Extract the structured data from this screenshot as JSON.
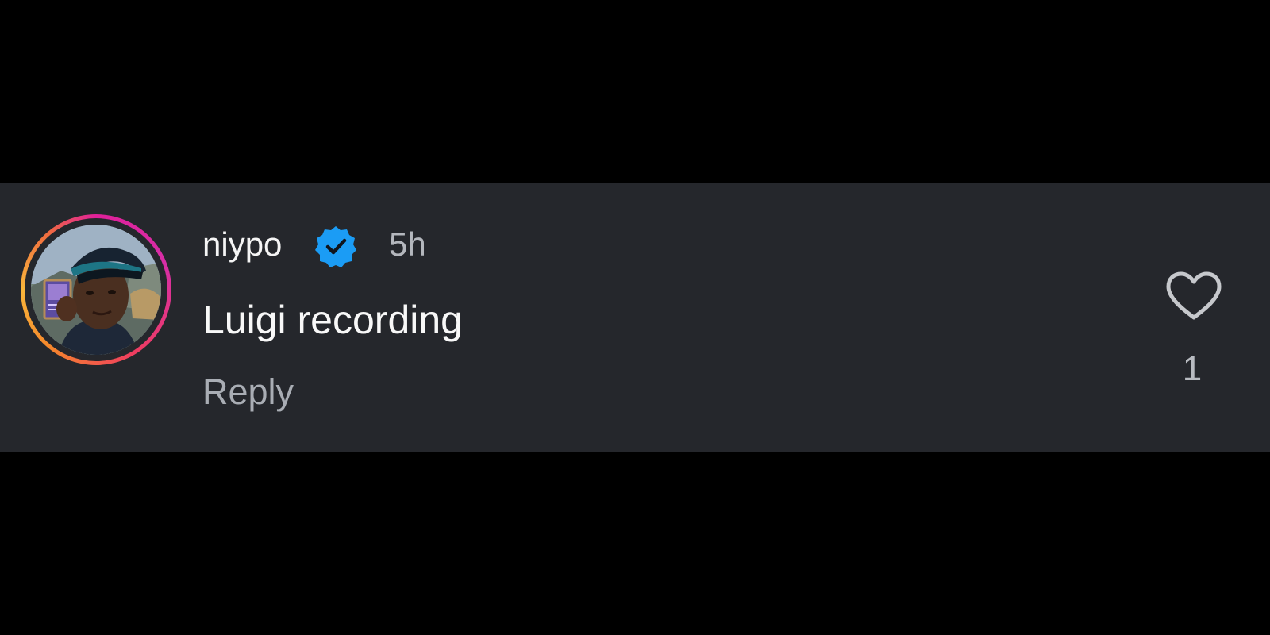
{
  "comment": {
    "username": "niypo",
    "verified_icon": "verified-badge-icon",
    "timestamp": "5h",
    "text": "Luigi recording",
    "reply_label": "Reply",
    "like_icon": "heart-outline-icon",
    "like_count": "1"
  },
  "colors": {
    "background": "#000000",
    "panel": "#25272c",
    "verified_blue": "#1b9cf5",
    "primary_text": "#f5f5f5",
    "secondary_text": "#a9adb4"
  }
}
